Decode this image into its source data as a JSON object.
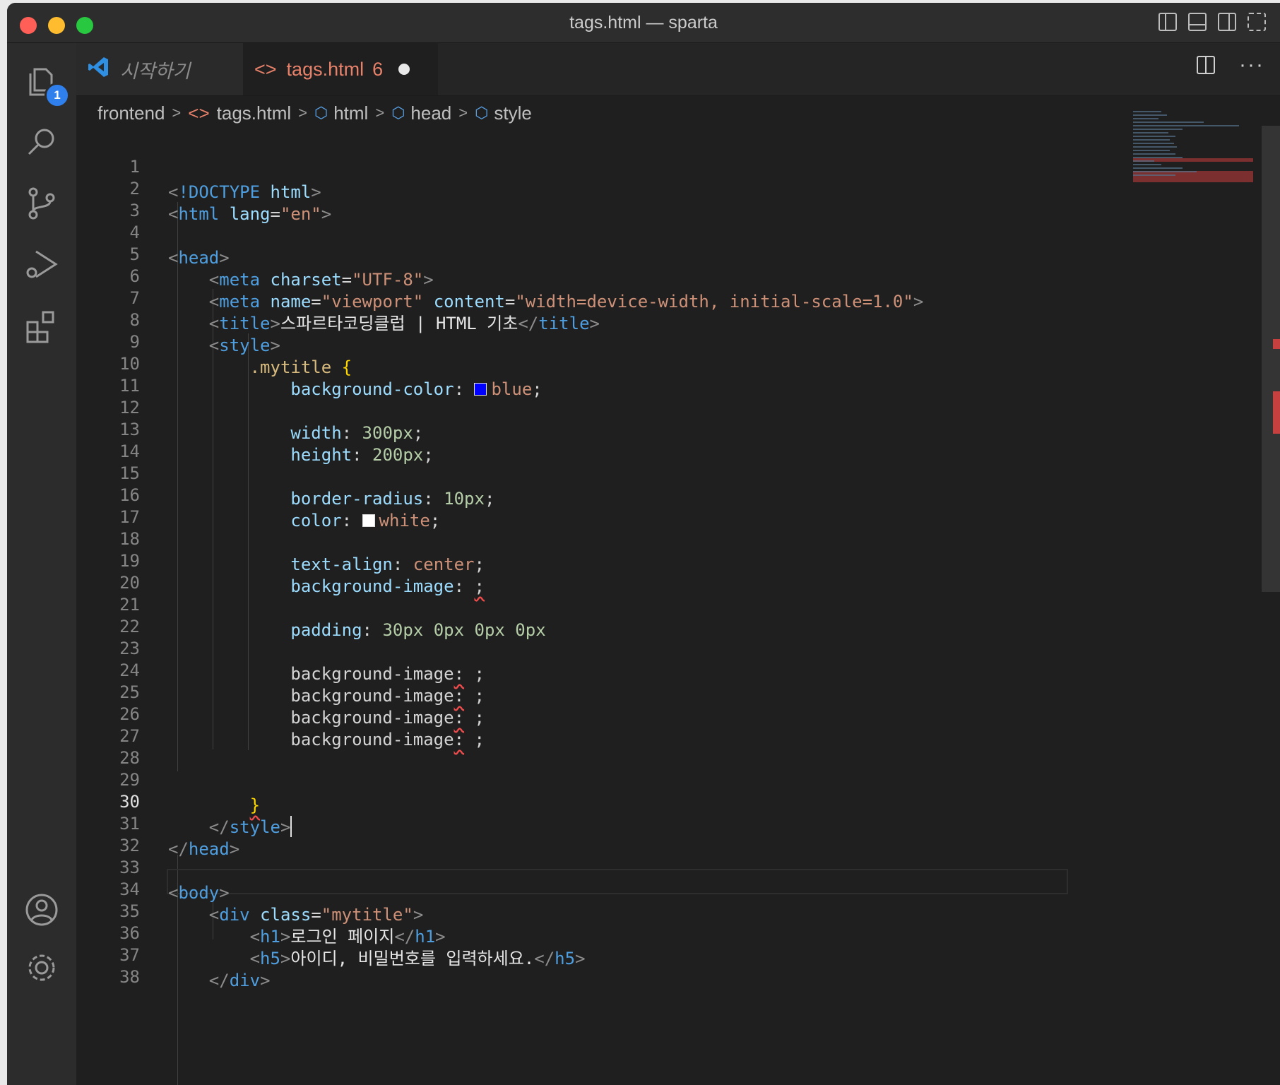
{
  "window": {
    "title": "tags.html — sparta"
  },
  "activity_bar": {
    "explorer_badge": "1",
    "items": [
      "files-icon",
      "search-icon",
      "source-control-icon",
      "run-debug-icon",
      "extensions-icon",
      "account-icon",
      "settings-gear-icon"
    ]
  },
  "tabs": {
    "start": {
      "label": "시작하기",
      "icon": "vscode-logo-icon"
    },
    "active": {
      "label": "tags.html",
      "problems": "6",
      "icon": "html-file-icon",
      "dirty": true
    }
  },
  "breadcrumb": {
    "folder": "frontend",
    "file": "tags.html",
    "symbols": [
      "html",
      "head",
      "style"
    ]
  },
  "editor": {
    "current_line": 30,
    "line_numbers": [
      "1",
      "2",
      "3",
      "4",
      "5",
      "6",
      "7",
      "8",
      "9",
      "10",
      "11",
      "12",
      "13",
      "14",
      "15",
      "16",
      "17",
      "18",
      "19",
      "20",
      "21",
      "22",
      "23",
      "24",
      "25",
      "26",
      "27",
      "28",
      "29",
      "30",
      "31",
      "32",
      "33",
      "34",
      "35",
      "36",
      "37",
      "38"
    ],
    "text": {
      "doctype": "!DOCTYPE",
      "html": "html",
      "lang_attr": "lang",
      "lang_val": "\"en\"",
      "head": "head",
      "meta": "meta",
      "charset_attr": "charset",
      "charset_val": "\"UTF-8\"",
      "name_attr": "name",
      "name_val": "\"viewport\"",
      "content_attr": "content",
      "content_val": "\"width=device-width, initial-scale=1.0\"",
      "title": "title",
      "title_text": "스파르타코딩클럽 | HTML 기초",
      "style": "style",
      "selector": ".mytitle",
      "bg_color_prop": "background-color",
      "bg_color_val": "blue",
      "width_prop": "width",
      "width_val": "300px",
      "height_prop": "height",
      "height_val": "200px",
      "radius_prop": "border-radius",
      "radius_val": "10px",
      "color_prop": "color",
      "color_val": "white",
      "align_prop": "text-align",
      "align_val": "center",
      "bg_image_prop": "background-image",
      "padding_prop": "padding",
      "padding_val": "30px 0px 0px 0px",
      "body": "body",
      "div": "div",
      "class_attr": "class",
      "class_val": "\"mytitle\"",
      "h1": "h1",
      "h1_text": "로그인 페이지",
      "h5": "h5",
      "h5_text": "아이디, 비밀번호를 입력하세요."
    }
  },
  "colors": {
    "swatch_blue": "#0000ff",
    "swatch_white": "#ffffff",
    "accent": "#2f80ed"
  }
}
